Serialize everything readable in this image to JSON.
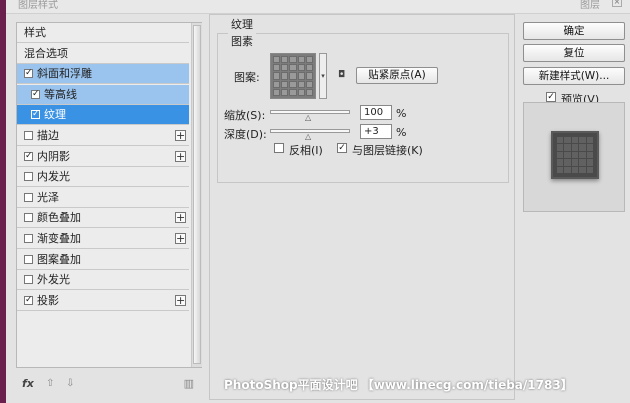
{
  "window": {
    "accent_color": "#6b1f4d",
    "title_partial": "图层样式",
    "title_right": "图层"
  },
  "style_list": {
    "items": [
      {
        "label": "样式",
        "checkbox": false,
        "checked": false,
        "plus": false,
        "selected": false,
        "indent": false
      },
      {
        "label": "混合选项",
        "checkbox": false,
        "checked": false,
        "plus": false,
        "selected": false,
        "indent": false
      },
      {
        "label": "斜面和浮雕",
        "checkbox": true,
        "checked": true,
        "plus": false,
        "selected": "light",
        "indent": false
      },
      {
        "label": "等高线",
        "checkbox": true,
        "checked": true,
        "plus": false,
        "selected": "light",
        "indent": true
      },
      {
        "label": "纹理",
        "checkbox": true,
        "checked": true,
        "plus": false,
        "selected": "strong",
        "indent": true
      },
      {
        "label": "描边",
        "checkbox": true,
        "checked": false,
        "plus": true,
        "selected": false,
        "indent": false
      },
      {
        "label": "内阴影",
        "checkbox": true,
        "checked": true,
        "plus": true,
        "selected": false,
        "indent": false
      },
      {
        "label": "内发光",
        "checkbox": true,
        "checked": false,
        "plus": false,
        "selected": false,
        "indent": false
      },
      {
        "label": "光泽",
        "checkbox": true,
        "checked": false,
        "plus": false,
        "selected": false,
        "indent": false
      },
      {
        "label": "颜色叠加",
        "checkbox": true,
        "checked": false,
        "plus": true,
        "selected": false,
        "indent": false
      },
      {
        "label": "渐变叠加",
        "checkbox": true,
        "checked": false,
        "plus": true,
        "selected": false,
        "indent": false
      },
      {
        "label": "图案叠加",
        "checkbox": true,
        "checked": false,
        "plus": false,
        "selected": false,
        "indent": false
      },
      {
        "label": "外发光",
        "checkbox": true,
        "checked": false,
        "plus": false,
        "selected": false,
        "indent": false
      },
      {
        "label": "投影",
        "checkbox": true,
        "checked": true,
        "plus": true,
        "selected": false,
        "indent": false
      }
    ],
    "footer": {
      "fx": "fx",
      "up": "⇧",
      "down": "⇩",
      "trash": "🗑"
    }
  },
  "texture": {
    "group_title": "纹理",
    "subgroup_title": "图素",
    "pattern_label": "图案:",
    "snap_button": "贴紧原点(A)",
    "scale_label": "缩放(S):",
    "scale_value": "100",
    "scale_unit": "%",
    "scale_fraction": 0.5,
    "depth_label": "深度(D):",
    "depth_value": "+3",
    "depth_unit": "%",
    "depth_fraction": 0.5,
    "invert_label": "反相(I)",
    "invert_checked": false,
    "link_label": "与图层链接(K)",
    "link_checked": true
  },
  "right": {
    "ok_label": "确定",
    "reset_label": "复位",
    "new_style_label": "新建样式(W)...",
    "preview_label": "预览(V)",
    "preview_checked": true
  },
  "watermark": "PhotoShop平面设计吧 【www.linecg.com/tieba/1783】"
}
